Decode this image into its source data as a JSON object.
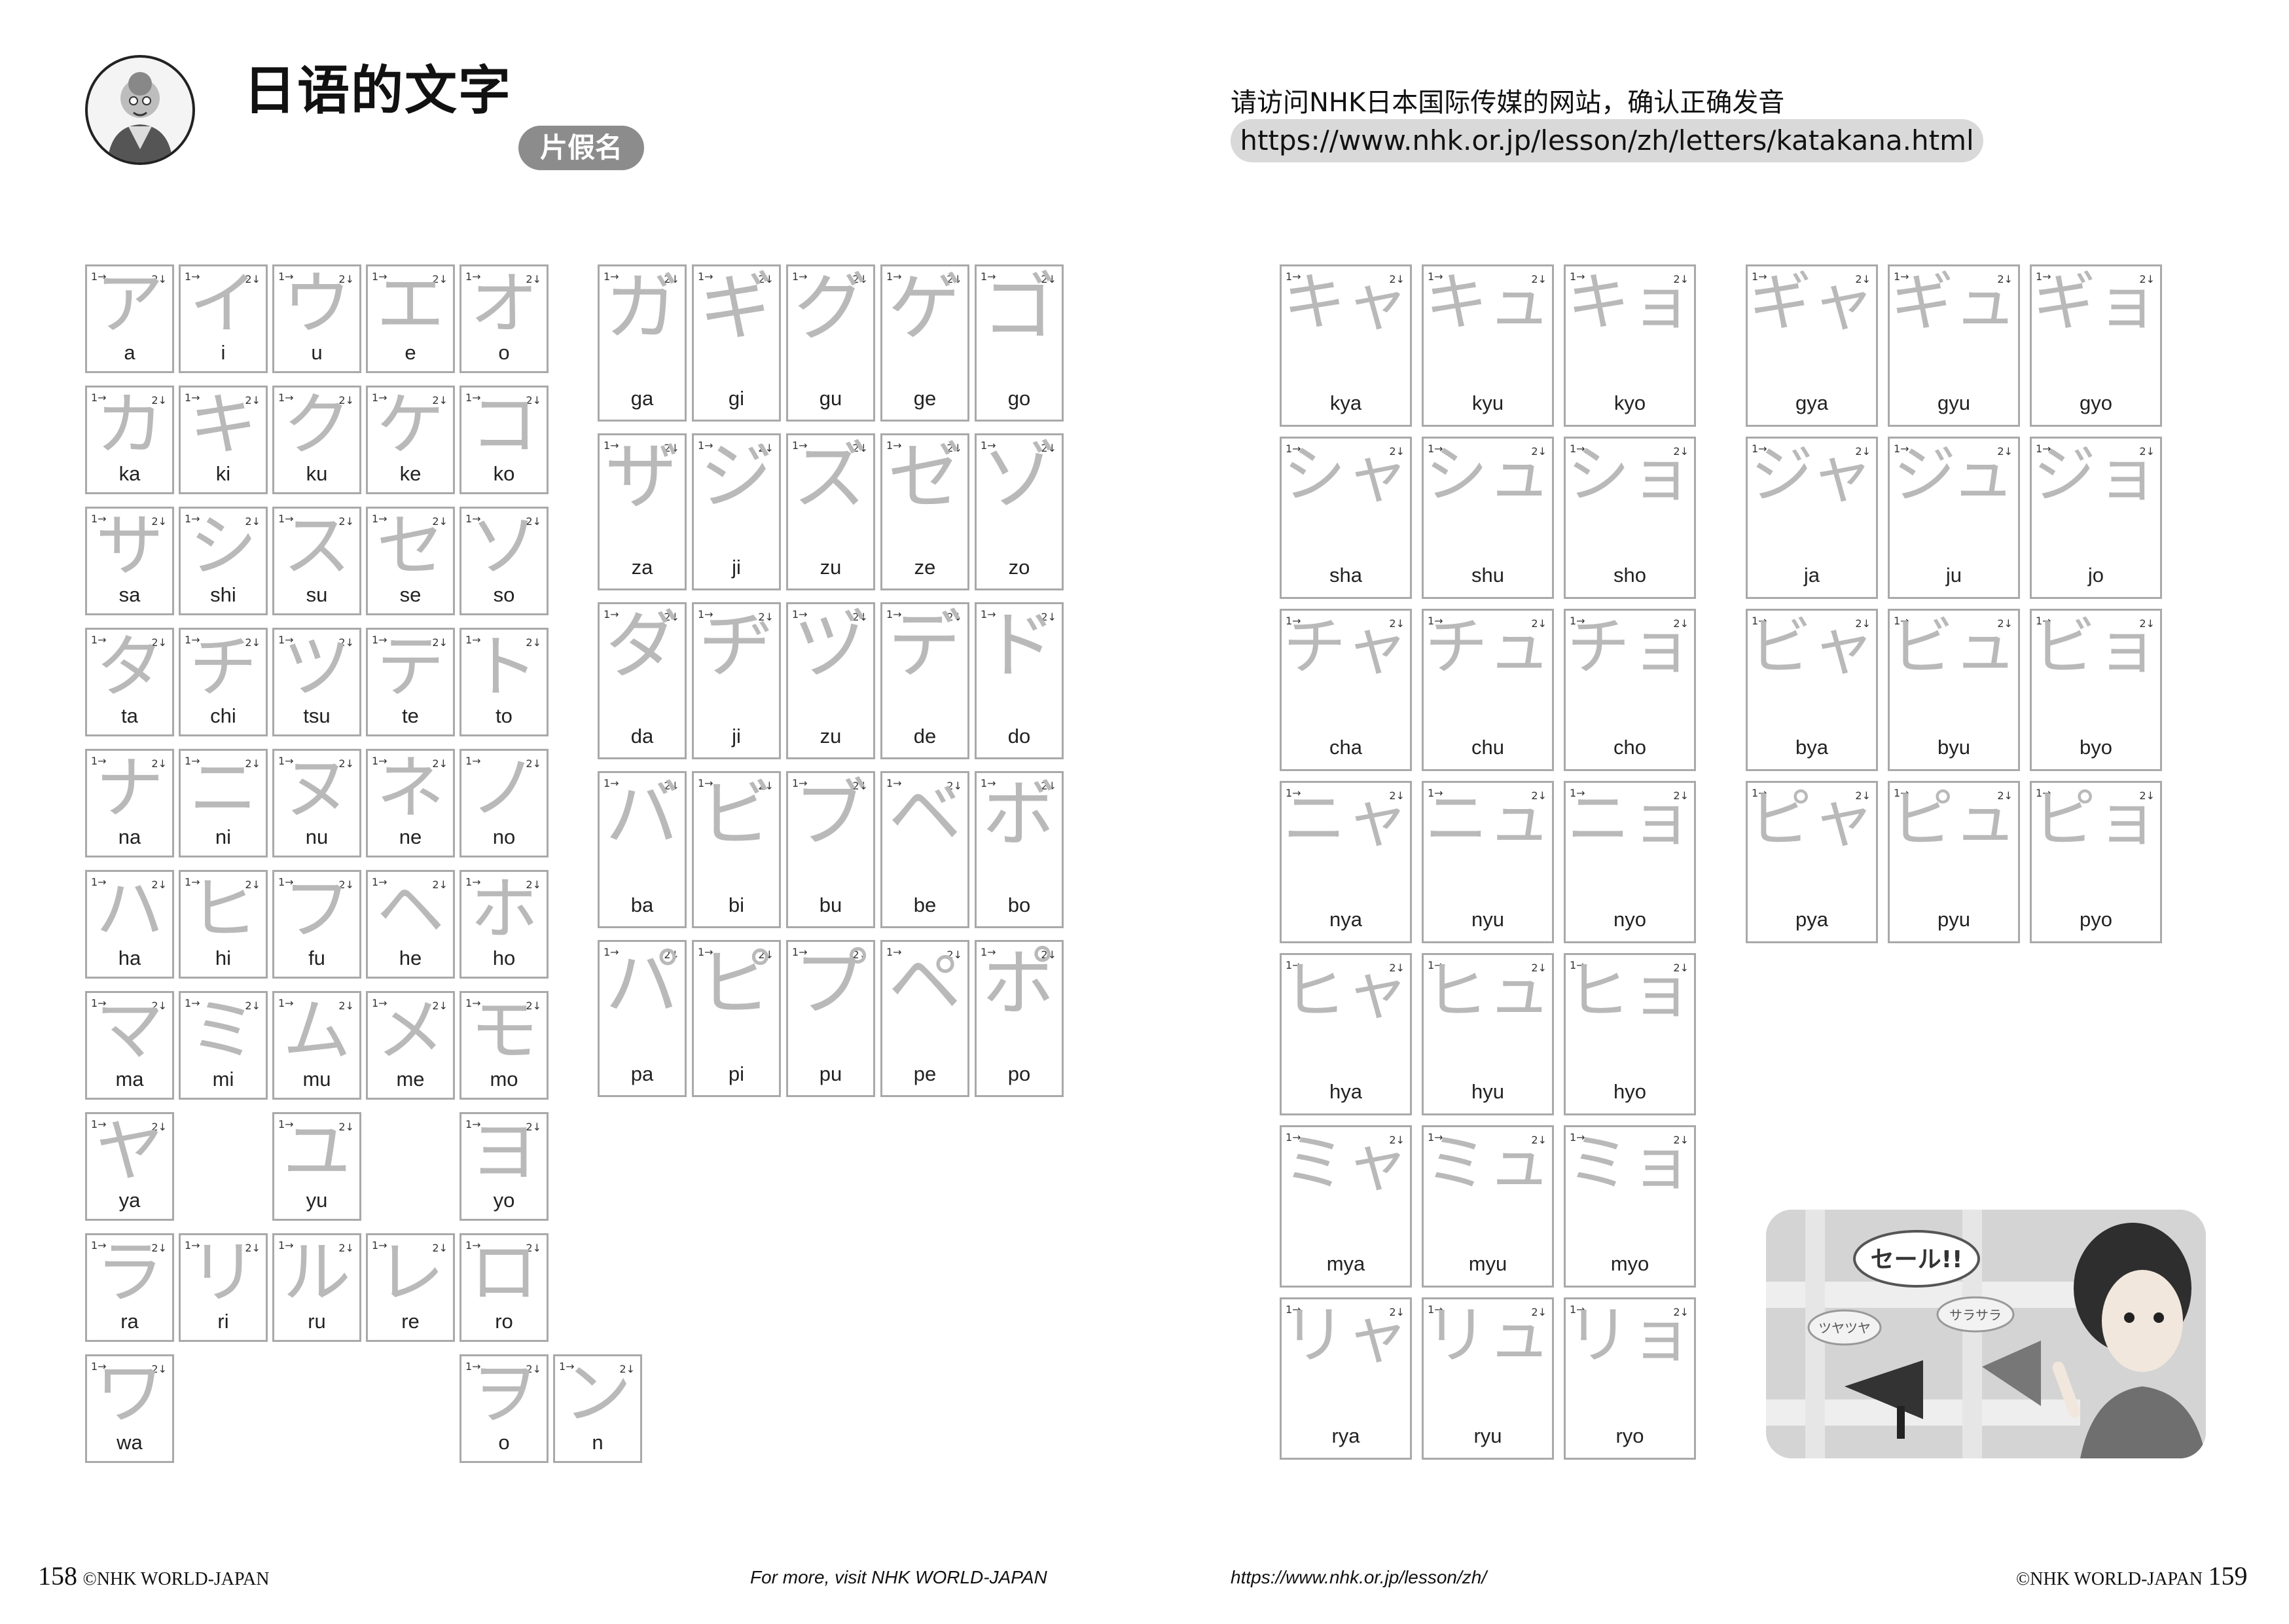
{
  "header": {
    "title": "日语的文字",
    "subtitle": "片假名",
    "notice": "请访问NHK日本国际传媒的网站，确认正确发音",
    "url": "https://www.nhk.or.jp/lesson/zh/letters/katakana.html"
  },
  "basic": [
    [
      [
        "ア",
        "a"
      ],
      [
        "イ",
        "i"
      ],
      [
        "ウ",
        "u"
      ],
      [
        "エ",
        "e"
      ],
      [
        "オ",
        "o"
      ]
    ],
    [
      [
        "カ",
        "ka"
      ],
      [
        "キ",
        "ki"
      ],
      [
        "ク",
        "ku"
      ],
      [
        "ケ",
        "ke"
      ],
      [
        "コ",
        "ko"
      ]
    ],
    [
      [
        "サ",
        "sa"
      ],
      [
        "シ",
        "shi"
      ],
      [
        "ス",
        "su"
      ],
      [
        "セ",
        "se"
      ],
      [
        "ソ",
        "so"
      ]
    ],
    [
      [
        "タ",
        "ta"
      ],
      [
        "チ",
        "chi"
      ],
      [
        "ツ",
        "tsu"
      ],
      [
        "テ",
        "te"
      ],
      [
        "ト",
        "to"
      ]
    ],
    [
      [
        "ナ",
        "na"
      ],
      [
        "ニ",
        "ni"
      ],
      [
        "ヌ",
        "nu"
      ],
      [
        "ネ",
        "ne"
      ],
      [
        "ノ",
        "no"
      ]
    ],
    [
      [
        "ハ",
        "ha"
      ],
      [
        "ヒ",
        "hi"
      ],
      [
        "フ",
        "fu"
      ],
      [
        "ヘ",
        "he"
      ],
      [
        "ホ",
        "ho"
      ]
    ],
    [
      [
        "マ",
        "ma"
      ],
      [
        "ミ",
        "mi"
      ],
      [
        "ム",
        "mu"
      ],
      [
        "メ",
        "me"
      ],
      [
        "モ",
        "mo"
      ]
    ],
    [
      [
        "ヤ",
        "ya"
      ],
      null,
      [
        "ユ",
        "yu"
      ],
      null,
      [
        "ヨ",
        "yo"
      ]
    ],
    [
      [
        "ラ",
        "ra"
      ],
      [
        "リ",
        "ri"
      ],
      [
        "ル",
        "ru"
      ],
      [
        "レ",
        "re"
      ],
      [
        "ロ",
        "ro"
      ]
    ],
    [
      [
        "ワ",
        "wa"
      ],
      null,
      null,
      null,
      [
        "ヲ",
        "o"
      ],
      [
        "ン",
        "n"
      ]
    ]
  ],
  "voiced": [
    [
      [
        "ガ",
        "ga"
      ],
      [
        "ギ",
        "gi"
      ],
      [
        "グ",
        "gu"
      ],
      [
        "ゲ",
        "ge"
      ],
      [
        "ゴ",
        "go"
      ]
    ],
    [
      [
        "ザ",
        "za"
      ],
      [
        "ジ",
        "ji"
      ],
      [
        "ズ",
        "zu"
      ],
      [
        "ゼ",
        "ze"
      ],
      [
        "ゾ",
        "zo"
      ]
    ],
    [
      [
        "ダ",
        "da"
      ],
      [
        "ヂ",
        "ji"
      ],
      [
        "ヅ",
        "zu"
      ],
      [
        "デ",
        "de"
      ],
      [
        "ド",
        "do"
      ]
    ],
    [
      [
        "バ",
        "ba"
      ],
      [
        "ビ",
        "bi"
      ],
      [
        "ブ",
        "bu"
      ],
      [
        "ベ",
        "be"
      ],
      [
        "ボ",
        "bo"
      ]
    ],
    [
      [
        "パ",
        "pa"
      ],
      [
        "ピ",
        "pi"
      ],
      [
        "プ",
        "pu"
      ],
      [
        "ペ",
        "pe"
      ],
      [
        "ポ",
        "po"
      ]
    ]
  ],
  "combo": [
    [
      [
        "キャ",
        "kya"
      ],
      [
        "キュ",
        "kyu"
      ],
      [
        "キョ",
        "kyo"
      ]
    ],
    [
      [
        "シャ",
        "sha"
      ],
      [
        "シュ",
        "shu"
      ],
      [
        "ショ",
        "sho"
      ]
    ],
    [
      [
        "チャ",
        "cha"
      ],
      [
        "チュ",
        "chu"
      ],
      [
        "チョ",
        "cho"
      ]
    ],
    [
      [
        "ニャ",
        "nya"
      ],
      [
        "ニュ",
        "nyu"
      ],
      [
        "ニョ",
        "nyo"
      ]
    ],
    [
      [
        "ヒャ",
        "hya"
      ],
      [
        "ヒュ",
        "hyu"
      ],
      [
        "ヒョ",
        "hyo"
      ]
    ],
    [
      [
        "ミャ",
        "mya"
      ],
      [
        "ミュ",
        "myu"
      ],
      [
        "ミョ",
        "myo"
      ]
    ],
    [
      [
        "リャ",
        "rya"
      ],
      [
        "リュ",
        "ryu"
      ],
      [
        "リョ",
        "ryo"
      ]
    ]
  ],
  "combo_voiced": [
    [
      [
        "ギャ",
        "gya"
      ],
      [
        "ギュ",
        "gyu"
      ],
      [
        "ギョ",
        "gyo"
      ]
    ],
    [
      [
        "ジャ",
        "ja"
      ],
      [
        "ジュ",
        "ju"
      ],
      [
        "ジョ",
        "jo"
      ]
    ],
    [
      [
        "ビャ",
        "bya"
      ],
      [
        "ビュ",
        "byu"
      ],
      [
        "ビョ",
        "byo"
      ]
    ],
    [
      [
        "ピャ",
        "pya"
      ],
      [
        "ピュ",
        "pyu"
      ],
      [
        "ピョ",
        "pyo"
      ]
    ]
  ],
  "illustration": {
    "bubble_main": "セール!!",
    "bubble_a": "ツヤツヤ",
    "bubble_b": "サラサラ"
  },
  "footer": {
    "left_page": "158",
    "left_copyright": "©NHK WORLD-JAPAN",
    "center_left": "For more, visit NHK WORLD-JAPAN",
    "center_right": "https://www.nhk.or.jp/lesson/zh/",
    "right_copyright": "©NHK WORLD-JAPAN",
    "right_page": "159"
  }
}
